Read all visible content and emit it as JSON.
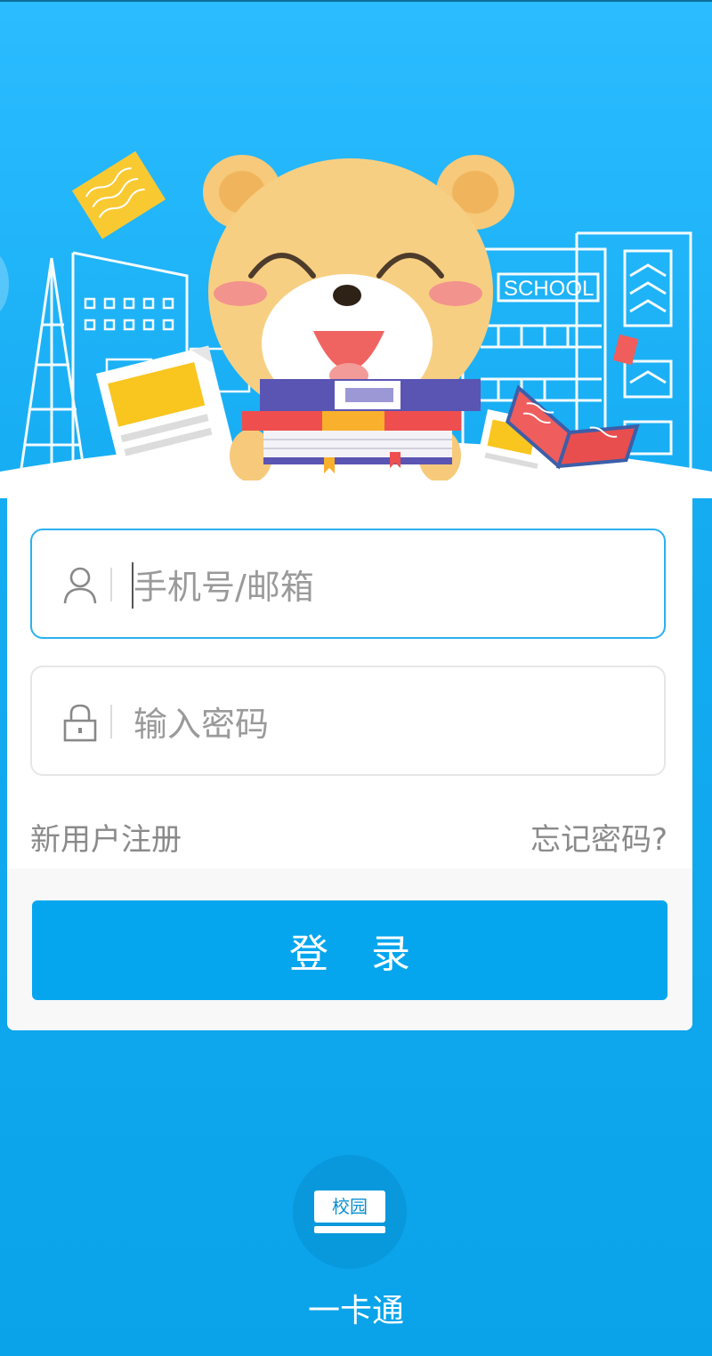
{
  "hero": {
    "school_sign": "SCHOOL"
  },
  "login": {
    "username_placeholder": "手机号/邮箱",
    "password_placeholder": "输入密码",
    "register_link": "新用户注册",
    "forgot_link": "忘记密码?",
    "submit_label": "登录"
  },
  "logo": {
    "badge_text": "校园",
    "caption": "一卡通"
  },
  "colors": {
    "primary": "#06a6ef",
    "background_top": "#2bbcff",
    "field_active_border": "#2ab1ef"
  },
  "icons": [
    "user-icon",
    "lock-icon",
    "campus-card-icon"
  ]
}
